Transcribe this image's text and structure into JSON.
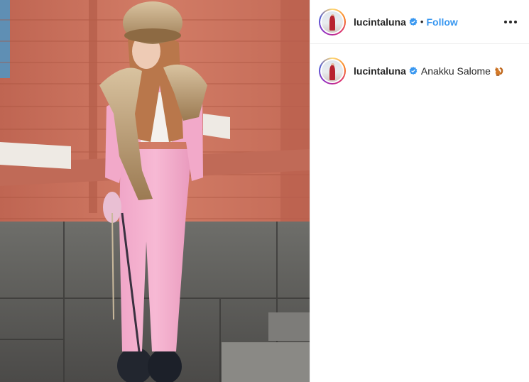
{
  "post": {
    "username": "lucintaluna",
    "follow_label": "Follow",
    "separator": "•",
    "more_icon": "more-horizontal-icon",
    "verified_icon": "verified-badge-icon"
  },
  "caption": {
    "username": "lucintaluna",
    "text": "Anakku Salome",
    "emoji_icon": "squirrel-emoji-icon"
  },
  "colors": {
    "follow": "#3897f0",
    "verified": "#3897f0",
    "text": "#262626"
  }
}
